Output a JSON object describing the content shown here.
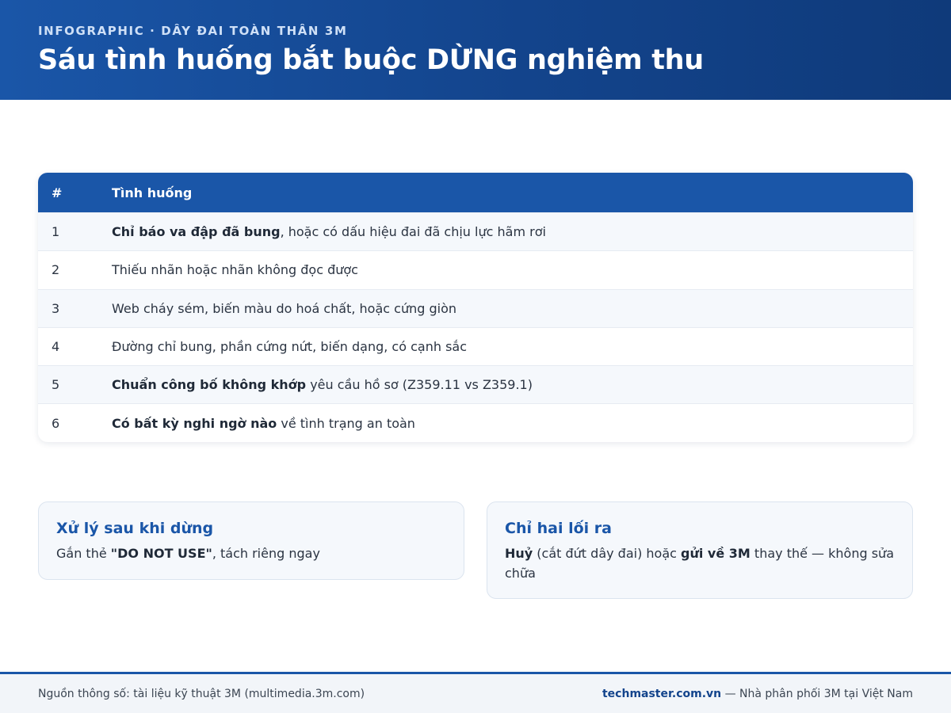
{
  "header": {
    "kicker": "INFOGRAPHIC · DÂY ĐAI TOÀN THÂN 3M",
    "title": "Sáu tình huống bắt buộc DỪNG nghiệm thu"
  },
  "table": {
    "headers": [
      "#",
      "Tình huống"
    ],
    "rows": [
      {
        "num": "1",
        "bold": "Chỉ báo va đập đã bung",
        "rest": ", hoặc có dấu hiệu đai đã chịu lực hãm rơi"
      },
      {
        "num": "2",
        "bold": "",
        "rest": "Thiếu nhãn hoặc nhãn không đọc được"
      },
      {
        "num": "3",
        "bold": "",
        "rest": "Web cháy sém, biến màu do hoá chất, hoặc cứng giòn"
      },
      {
        "num": "4",
        "bold": "",
        "rest": "Đường chỉ bung, phần cứng nứt, biến dạng, có cạnh sắc"
      },
      {
        "num": "5",
        "bold": "Chuẩn công bố không khớp",
        "rest": " yêu cầu hồ sơ (Z359.11 vs Z359.1)"
      },
      {
        "num": "6",
        "bold": "Có bất kỳ nghi ngờ nào",
        "rest": " về tình trạng an toàn"
      }
    ]
  },
  "cards": {
    "left": {
      "title": "Xử lý sau khi dừng",
      "pre": "Gắn thẻ ",
      "bold": "\"DO NOT USE\"",
      "post": ", tách riêng ngay"
    },
    "right": {
      "title": "Chỉ hai lối ra",
      "bold1": "Huỷ",
      "mid": " (cắt đứt dây đai) hoặc ",
      "bold2": "gửi về 3M",
      "post": " thay thế — không sửa chữa"
    }
  },
  "footer": {
    "source": "Nguồn thông số: tài liệu kỹ thuật 3M (multimedia.3m.com)",
    "site": "techmaster.com.vn",
    "tagline": " — Nhà phân phối 3M tại Việt Nam"
  }
}
